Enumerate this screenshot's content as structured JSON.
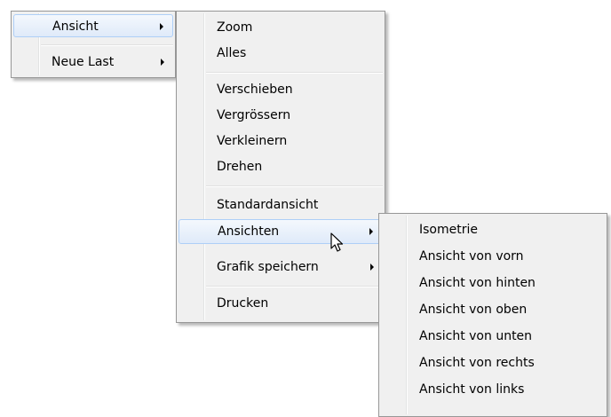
{
  "menu1": {
    "items": [
      {
        "label": "Ansicht",
        "submenu": true
      },
      {
        "label": "Neue Last",
        "submenu": true
      }
    ]
  },
  "menu2": {
    "items": [
      {
        "label": "Zoom"
      },
      {
        "label": "Alles"
      },
      {
        "label": "Verschieben"
      },
      {
        "label": "Vergrössern"
      },
      {
        "label": "Verkleinern"
      },
      {
        "label": "Drehen"
      },
      {
        "label": "Standardansicht"
      },
      {
        "label": "Ansichten",
        "submenu": true
      },
      {
        "label": "Grafik speichern",
        "submenu": true
      },
      {
        "label": "Drucken"
      }
    ]
  },
  "menu3": {
    "items": [
      {
        "label": "Isometrie"
      },
      {
        "label": "Ansicht von vorn"
      },
      {
        "label": "Ansicht von hinten"
      },
      {
        "label": "Ansicht von oben"
      },
      {
        "label": "Ansicht von unten"
      },
      {
        "label": "Ansicht von rechts"
      },
      {
        "label": "Ansicht von links"
      }
    ]
  },
  "colors": {
    "menu_bg": "#f0f0f0",
    "menu_border": "#979797",
    "highlight_border": "#aecff7",
    "highlight_fill": "#dfeaf9"
  }
}
